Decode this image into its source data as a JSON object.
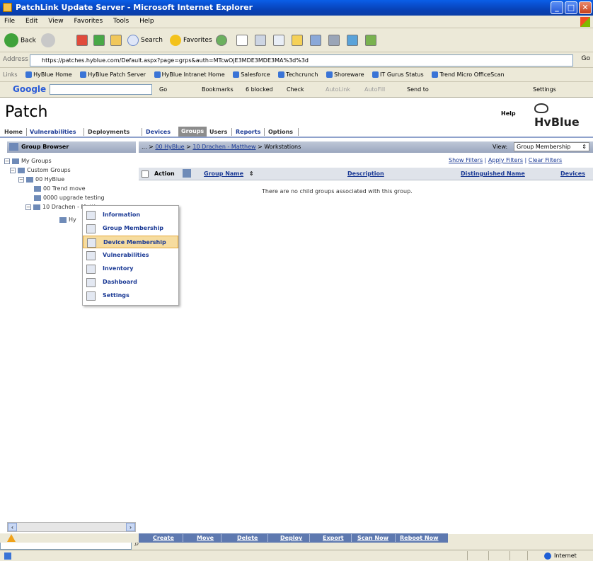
{
  "window": {
    "title": "PatchLink Update Server - Microsoft Internet Explorer"
  },
  "menu": [
    "File",
    "Edit",
    "View",
    "Favorites",
    "Tools",
    "Help"
  ],
  "toolbar": {
    "back_label": "Back",
    "search_label": "Search",
    "favorites_label": "Favorites"
  },
  "address": {
    "label": "Address",
    "url": "https://patches.hyblue.com/Default.aspx?page=grps&auth=MTcwOjE3MDE3MDE3MA%3d%3d",
    "go_label": "Go"
  },
  "links": {
    "label": "Links",
    "items": [
      "HyBlue Home",
      "HyBlue Patch Server",
      "HyBlue Intranet Home",
      "Salesforce",
      "Techcrunch",
      "Shoreware",
      "IT Gurus Status",
      "Trend Micro OfficeScan"
    ]
  },
  "google": {
    "brand": "Google",
    "go_label": "Go",
    "bookmarks_label": "Bookmarks",
    "blocked_label": "6 blocked",
    "check_label": "Check",
    "autolink_label": "AutoLink",
    "autofill_label": "AutoFill",
    "sendto_label": "Send to",
    "settings_label": "Settings"
  },
  "app": {
    "title": "Patch",
    "help_label": "Help",
    "logo_text": "HyBlue"
  },
  "nav": {
    "items": [
      "Home",
      "Vulnerabilities",
      "Deployments",
      "Devices",
      "Groups",
      "Users",
      "Reports",
      "Options"
    ],
    "active": "Groups"
  },
  "left": {
    "header": "Group Browser",
    "tree": [
      "My Groups",
      "Custom Groups",
      "00 HyBlue",
      "00 Trend move",
      "0000 upgrade testing",
      "10 Drachen - Matthew",
      "Hy"
    ]
  },
  "popup": {
    "items": [
      "Information",
      "Group Membership",
      "Device Membership",
      "Vulnerabilities",
      "Inventory",
      "Dashboard",
      "Settings"
    ],
    "highlighted": "Device Membership"
  },
  "breadcrumb": {
    "prefix": "... >",
    "links": [
      "00 HyBlue",
      "10 Drachen - Matthew"
    ],
    "current": "> Workstations"
  },
  "view": {
    "label": "View:",
    "value": "Group Membership"
  },
  "filters": [
    "Show Filters",
    "Apply Filters",
    "Clear Filters"
  ],
  "columns": [
    "Action",
    "Group Name",
    "Description",
    "Distinguished Name",
    "Devices"
  ],
  "empty_message": "There are no child groups associated with this group.",
  "actions": [
    "Create",
    "Move",
    "Delete",
    "Deploy",
    "Export",
    "Scan Now",
    "Reboot Now"
  ],
  "status": {
    "zone": "Internet"
  },
  "colors": {
    "nav_link": "#1b3a95",
    "active_tab": "#8c8c8c",
    "button_bar": "#5e79b0",
    "highlight": "#f6dc9f"
  }
}
